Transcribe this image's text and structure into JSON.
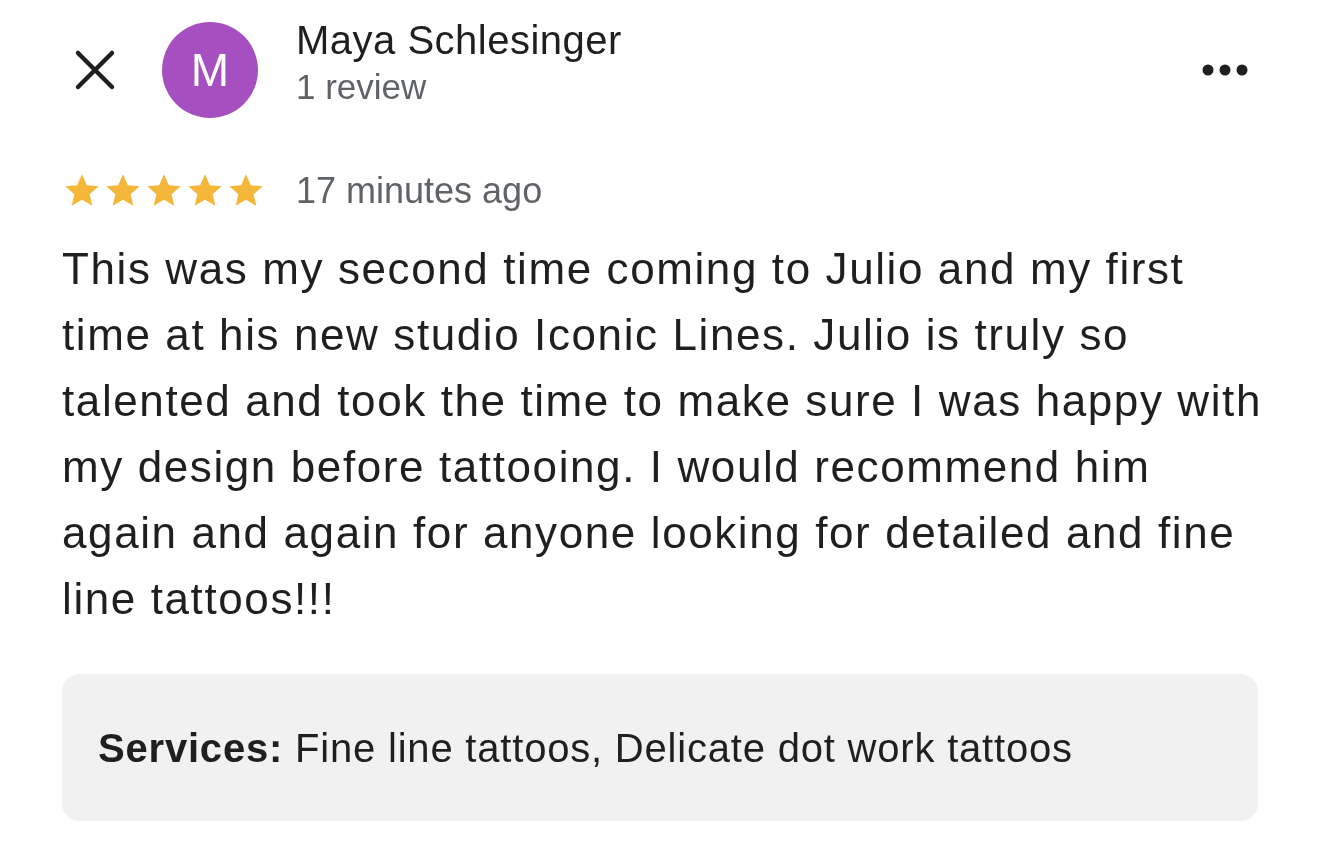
{
  "header": {
    "avatar_letter": "M",
    "name": "Maya Schlesinger",
    "subtitle": "1 review"
  },
  "rating": {
    "stars": 5,
    "time": "17 minutes ago"
  },
  "review_text": "This was my second time coming to Julio and my first time at his new studio Iconic Lines. Julio is truly so talented and took the time to make sure I was happy with my design before tattooing. I would recommend him again and again for anyone looking for detailed and fine line tattoos!!!",
  "services": "**Services:** Fine line tattoos, Delicate dot work tattoos"
}
